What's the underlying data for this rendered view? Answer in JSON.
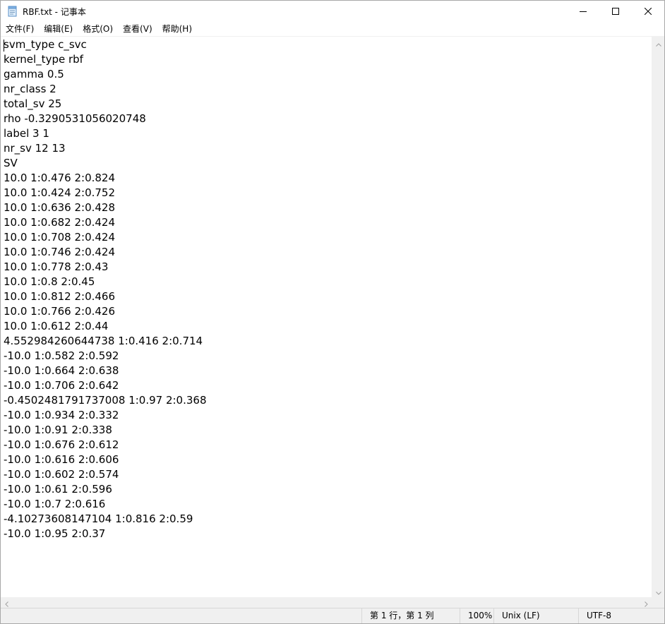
{
  "window": {
    "title": "RBF.txt - 记事本",
    "icon": "notepad-icon",
    "controls": {
      "minimize": "minimize-icon",
      "maximize": "maximize-icon",
      "close": "close-icon"
    }
  },
  "menu": [
    {
      "label": "文件(F)"
    },
    {
      "label": "编辑(E)"
    },
    {
      "label": "格式(O)"
    },
    {
      "label": "查看(V)"
    },
    {
      "label": "帮助(H)"
    }
  ],
  "editor": {
    "lines": [
      "svm_type c_svc",
      "kernel_type rbf",
      "gamma 0.5",
      "nr_class 2",
      "total_sv 25",
      "rho -0.3290531056020748",
      "label 3 1",
      "nr_sv 12 13",
      "SV",
      "10.0 1:0.476 2:0.824",
      "10.0 1:0.424 2:0.752",
      "10.0 1:0.636 2:0.428",
      "10.0 1:0.682 2:0.424",
      "10.0 1:0.708 2:0.424",
      "10.0 1:0.746 2:0.424",
      "10.0 1:0.778 2:0.43",
      "10.0 1:0.8 2:0.45",
      "10.0 1:0.812 2:0.466",
      "10.0 1:0.766 2:0.426",
      "10.0 1:0.612 2:0.44",
      "4.552984260644738 1:0.416 2:0.714",
      "-10.0 1:0.582 2:0.592",
      "-10.0 1:0.664 2:0.638",
      "-10.0 1:0.706 2:0.642",
      "-0.4502481791737008 1:0.97 2:0.368",
      "-10.0 1:0.934 2:0.332",
      "-10.0 1:0.91 2:0.338",
      "-10.0 1:0.676 2:0.612",
      "-10.0 1:0.616 2:0.606",
      "-10.0 1:0.602 2:0.574",
      "-10.0 1:0.61 2:0.596",
      "-10.0 1:0.7 2:0.616",
      "-4.10273608147104 1:0.816 2:0.59",
      "-10.0 1:0.95 2:0.37"
    ]
  },
  "status": {
    "position": "第 1 行，第 1 列",
    "zoom": "100%",
    "line_ending": "Unix (LF)",
    "encoding": "UTF-8"
  }
}
